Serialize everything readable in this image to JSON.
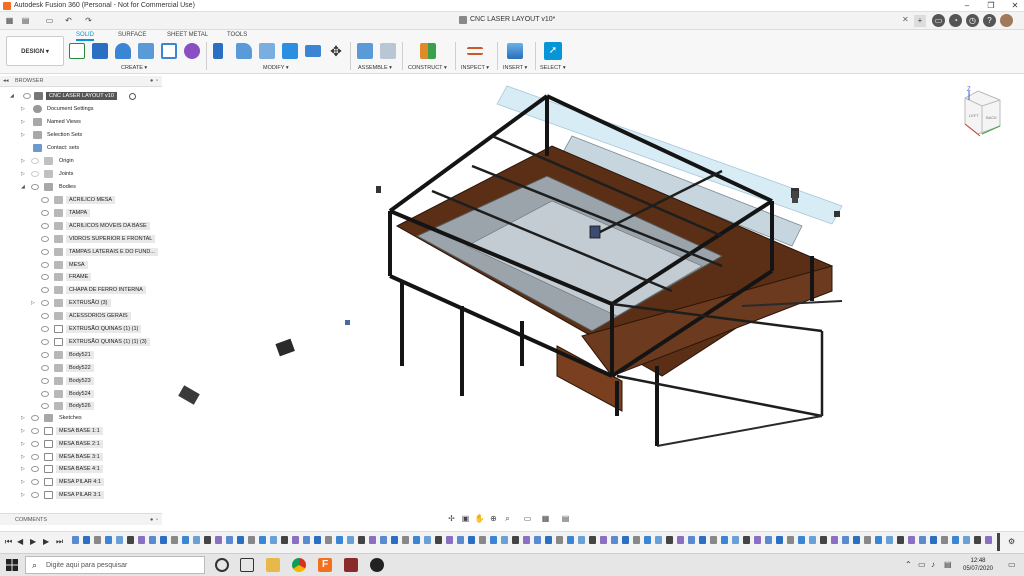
{
  "window": {
    "title": "Autodesk Fusion 360 (Personal - Not for Commercial Use)"
  },
  "document_tab": {
    "title": "CNC LASER LAYOUT v10*"
  },
  "toolbar": {
    "workspace_button": "DESIGN ▾",
    "tabs": [
      "SOLID",
      "SURFACE",
      "SHEET METAL",
      "TOOLS"
    ],
    "active_tab": "SOLID",
    "groups": {
      "create": "CREATE ▾",
      "modify": "MODIFY ▾",
      "assemble": "ASSEMBLE ▾",
      "construct": "CONSTRUCT ▾",
      "inspect": "INSPECT ▾",
      "insert": "INSERT ▾",
      "select": "SELECT ▾"
    }
  },
  "browser": {
    "header": "BROWSER",
    "root": "CNC LASER LAYOUT v10",
    "items": [
      {
        "label": "Document Settings"
      },
      {
        "label": "Named Views"
      },
      {
        "label": "Selection Sets"
      },
      {
        "label": "Contact: sets"
      },
      {
        "label": "Origin"
      },
      {
        "label": "Joints"
      },
      {
        "label": "Bodies"
      }
    ],
    "bodies": [
      "ACRILICO MESA",
      "TAMPA",
      "ACRILICOS MOVEIS DA BASE",
      "VIDROS SUPERIOR E FRONTAL",
      "TAMPAS LATERAIS E DO FUND...",
      "MESA",
      "FRAME",
      "CHAPA DE FERRO INTERNA",
      "EXTRUSÃO (3)",
      "ACESSORIOS GERAIS",
      "EXTRUSÃO QUINAS (1) (1)",
      "EXTRUSÃO QUINAS (1) (1) (3)",
      "Body521",
      "Body522",
      "Body523",
      "Body524",
      "Body526"
    ],
    "sketches_label": "Sketches",
    "sketches": [
      "MESA BASE 1:1",
      "MESA BASE 2:1",
      "MESA BASE 3:1",
      "MESA BASE 4:1",
      "MESA PILAR 4:1",
      "MESA PILAR 3:1"
    ]
  },
  "comments": {
    "label": "COMMENTS"
  },
  "taskbar": {
    "search_placeholder": "Digite aqui para pesquisar",
    "time": "12:48",
    "date": "05/07/2020"
  },
  "colors": {
    "accent": "#0696d7",
    "frame": "#1a1a1a",
    "wood": "#6b3a1f",
    "glass": "#cfe6f2"
  }
}
